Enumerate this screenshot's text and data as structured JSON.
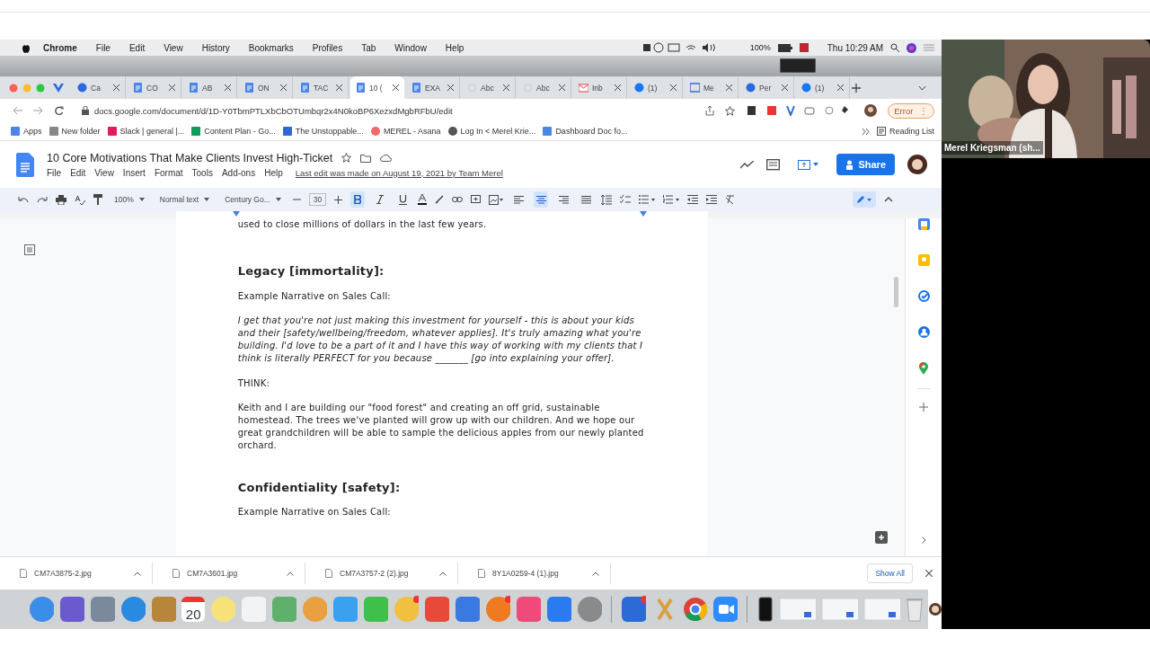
{
  "menubar": {
    "app": "Chrome",
    "items": [
      "File",
      "Edit",
      "View",
      "History",
      "Bookmarks",
      "Profiles",
      "Tab",
      "Window",
      "Help"
    ],
    "battery": "100%",
    "clock": "Thu 10:29 AM"
  },
  "tabs": [
    {
      "label": "Ca",
      "kind": "globe",
      "selected": false
    },
    {
      "label": "CO",
      "kind": "docs",
      "selected": false
    },
    {
      "label": "AB",
      "kind": "docs",
      "selected": false
    },
    {
      "label": "ON",
      "kind": "docs",
      "selected": false
    },
    {
      "label": "TAC",
      "kind": "docs",
      "selected": false
    },
    {
      "label": "10 (",
      "kind": "docs",
      "selected": true
    },
    {
      "label": "EXA",
      "kind": "docs",
      "selected": false
    },
    {
      "label": "Abc",
      "kind": "blank",
      "selected": false
    },
    {
      "label": "Abc",
      "kind": "blank",
      "selected": false
    },
    {
      "label": "Inb",
      "kind": "mail",
      "selected": false
    },
    {
      "label": "(1)",
      "kind": "social",
      "selected": false
    },
    {
      "label": "Me",
      "kind": "page",
      "selected": false
    },
    {
      "label": "Per",
      "kind": "globe",
      "selected": false
    },
    {
      "label": "(1)",
      "kind": "social",
      "selected": false
    }
  ],
  "address": {
    "url": "docs.google.com/document/d/1D-Y0TbmPTLXbCbOTUmbqr2x4N0koBP6XezxdMgbRFbU/edit",
    "error_button": "Error",
    "error_menu": "⋮"
  },
  "bookmarks": [
    {
      "label": "Apps",
      "kind": "apps"
    },
    {
      "label": "New folder",
      "kind": "folder"
    },
    {
      "label": "Slack | general |...",
      "kind": "slack"
    },
    {
      "label": "Content Plan - Go...",
      "kind": "sheet"
    },
    {
      "label": "The Unstoppable...",
      "kind": "page"
    },
    {
      "label": "MEREL - Asana",
      "kind": "asana"
    },
    {
      "label": "Log In < Merel Krie...",
      "kind": "globe"
    },
    {
      "label": "Dashboard Doc fo...",
      "kind": "docs"
    }
  ],
  "reading_list": "Reading List",
  "doc": {
    "title": "10 Core Motivations That Make Clients Invest High-Ticket",
    "menus": [
      "File",
      "Edit",
      "View",
      "Insert",
      "Format",
      "Tools",
      "Add-ons",
      "Help"
    ],
    "last_edit": "Last edit was made on August 19, 2021 by Team Merel",
    "share": "Share"
  },
  "toolbar": {
    "zoom": "100%",
    "style": "Normal text",
    "font": "Century Go...",
    "size": "30",
    "bold": true,
    "italic": false,
    "underline": false,
    "alignments": [
      {
        "selected": false
      },
      {
        "selected": true
      },
      {
        "selected": false
      },
      {
        "selected": false
      }
    ]
  },
  "content": [
    {
      "kind": "body",
      "text": "used to close millions of dollars in the last few years."
    },
    {
      "kind": "heading",
      "text": "Legacy [immortality]:"
    },
    {
      "kind": "body",
      "text": "Example Narrative on Sales Call:"
    },
    {
      "kind": "quote",
      "text": "I get that you're not just making this investment for yourself - this is about your kids and their [safety/wellbeing/freedom, whatever applies]. It's truly amazing what you're building. I'd love to be a part of it and I have this way of working with my clients that I think is literally PERFECT for you  because _______ [go into explaining your offer]."
    },
    {
      "kind": "body",
      "text": "THINK:"
    },
    {
      "kind": "body",
      "text": "Keith and I are building our \"food forest\" and creating an off grid, sustainable homestead. The trees we've planted will grow up with our children. And we hope our great grandchildren will be able to sample the delicious apples from our newly planted orchard."
    },
    {
      "kind": "heading",
      "text": "Confidentiality [safety]:"
    },
    {
      "kind": "body",
      "text": "Example Narrative on Sales Call:"
    }
  ],
  "downloads": {
    "files": [
      "CM7A3875-2.jpg",
      "CM7A3601.jpg",
      "CM7A3757-2 (2).jpg",
      "8Y1A0259-4 (1).jpg"
    ],
    "show_all": "Show All"
  },
  "dock": {
    "calendar_day": "20"
  },
  "video": {
    "kind": "picture",
    "name": "Merel Kriegsman (sh..."
  }
}
